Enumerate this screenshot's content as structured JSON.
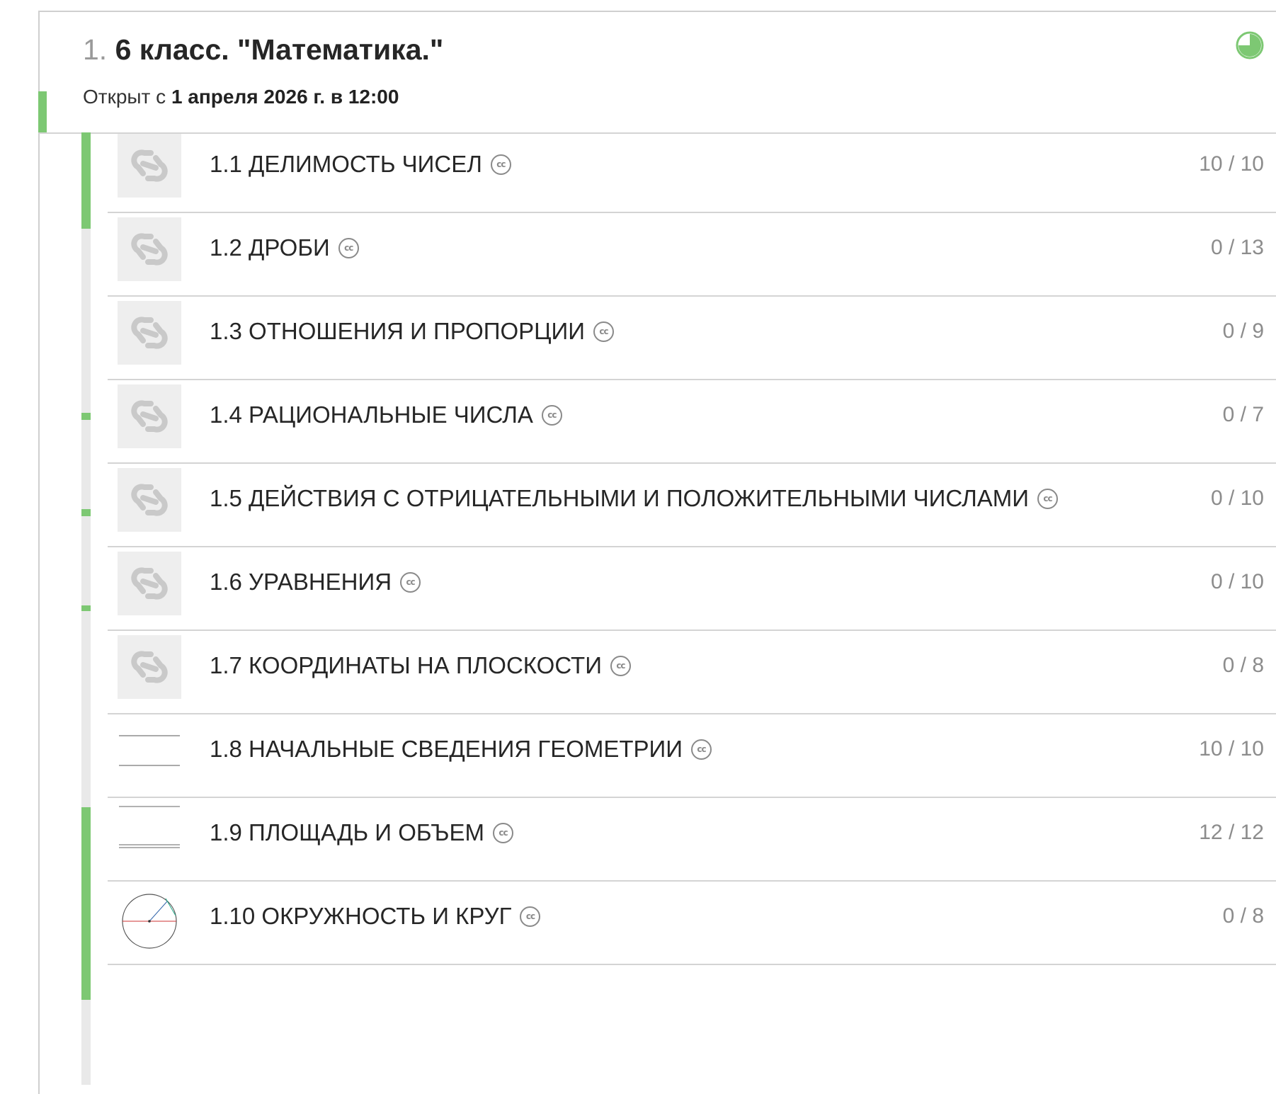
{
  "module": {
    "number": "1.",
    "title": "6 класс. \"Математика.\"",
    "open_prefix": "Открыт с",
    "open_date": "1 апреля 2026 г. в 12:00",
    "progress_icon": "pie-progress-icon",
    "accent_color": "#7dc873"
  },
  "lessons": [
    {
      "title": "1.1 ДЕЛИМОСТЬ ЧИСЕЛ",
      "license": "cc",
      "score": "10 / 10",
      "thumb": "link-icon",
      "completed": true
    },
    {
      "title": "1.2 ДРОБИ",
      "license": "cc",
      "score": "0 / 13",
      "thumb": "link-icon",
      "completed": false
    },
    {
      "title": "1.3 ОТНОШЕНИЯ И ПРОПОРЦИИ",
      "license": "cc",
      "score": "0 / 9",
      "thumb": "link-icon",
      "completed": false
    },
    {
      "title": "1.4 РАЦИОНАЛЬНЫЕ ЧИСЛА",
      "license": "cc",
      "score": "0 / 7",
      "thumb": "link-icon",
      "completed": false
    },
    {
      "title": "1.5 ДЕЙСТВИЯ С ОТРИЦАТЕЛЬНЫМИ И ПОЛОЖИТЕЛЬНЫМИ ЧИСЛАМИ",
      "license": "cc",
      "score": "0 / 10",
      "thumb": "link-icon",
      "completed": false
    },
    {
      "title": "1.6 УРАВНЕНИЯ",
      "license": "cc",
      "score": "0 / 10",
      "thumb": "link-icon",
      "completed": false
    },
    {
      "title": "1.7 КООРДИНАТЫ НА ПЛОСКОСТИ",
      "license": "cc",
      "score": "0 / 8",
      "thumb": "link-icon",
      "completed": false
    },
    {
      "title": "1.8 НАЧАЛЬНЫЕ СВЕДЕНИЯ ГЕОМЕТРИИ",
      "license": "cc",
      "score": "10 / 10",
      "thumb": "lines-thumbnail",
      "completed": true
    },
    {
      "title": "1.9 ПЛОЩАДЬ И ОБЪЕМ",
      "license": "cc",
      "score": "12 / 12",
      "thumb": "area-thumbnail",
      "completed": true
    },
    {
      "title": "1.10 ОКРУЖНОСТЬ И КРУГ",
      "license": "cc",
      "score": "0 / 8",
      "thumb": "circle-thumbnail",
      "completed": false
    }
  ]
}
